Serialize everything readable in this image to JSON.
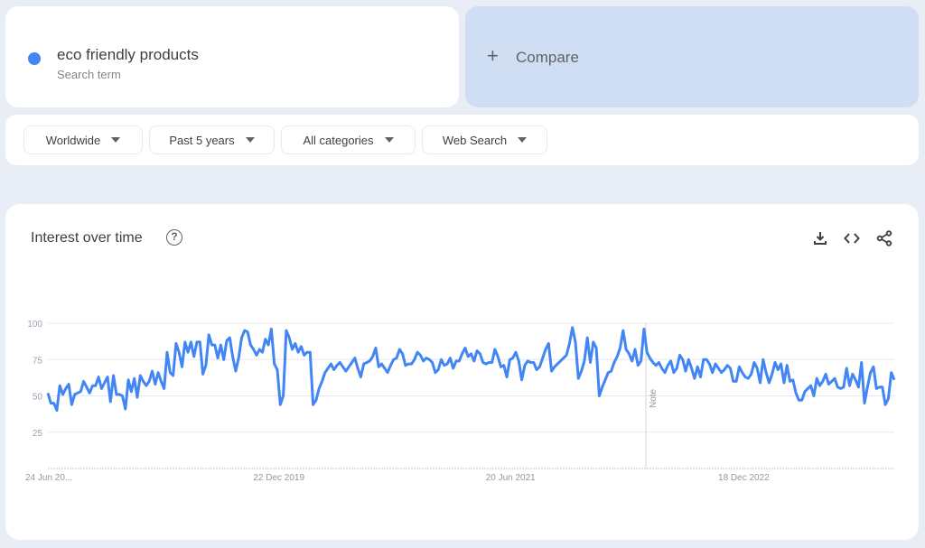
{
  "search_term": {
    "name": "eco friendly products",
    "subtitle": "Search term",
    "color": "#4285f4"
  },
  "compare": {
    "icon": "plus-icon",
    "label": "Compare"
  },
  "filters": [
    {
      "label": "Worldwide",
      "icon": "caret-down-icon"
    },
    {
      "label": "Past 5 years",
      "icon": "caret-down-icon"
    },
    {
      "label": "All categories",
      "icon": "caret-down-icon"
    },
    {
      "label": "Web Search",
      "icon": "caret-down-icon"
    }
  ],
  "panel": {
    "title": "Interest over time",
    "help_icon": "help-circle-icon",
    "help_glyph": "?",
    "actions": [
      "download-icon",
      "embed-code-icon",
      "share-icon"
    ]
  },
  "chart_data": {
    "type": "line",
    "title": "Interest over time",
    "xlabel": "",
    "ylabel": "",
    "ylim": [
      0,
      100
    ],
    "yticks": [
      25,
      50,
      75,
      100
    ],
    "xtick_labels": [
      "24 Jun 20...",
      "22 Dec 2019",
      "20 Jun 2021",
      "18 Dec 2022"
    ],
    "xtick_indices": [
      0,
      78,
      156,
      234
    ],
    "grid": true,
    "annotation": {
      "label": "Note",
      "index": 178
    },
    "series": [
      {
        "name": "eco friendly products",
        "color": "#4285f4",
        "values": [
          52,
          45,
          45,
          40,
          57,
          51,
          55,
          58,
          44,
          51,
          52,
          53,
          60,
          56,
          52,
          57,
          57,
          63,
          55,
          59,
          63,
          46,
          64,
          51,
          51,
          50,
          41,
          61,
          53,
          62,
          49,
          64,
          60,
          57,
          60,
          67,
          58,
          66,
          60,
          55,
          80,
          66,
          64,
          86,
          80,
          70,
          87,
          80,
          87,
          77,
          87,
          87,
          65,
          71,
          92,
          85,
          85,
          76,
          85,
          75,
          88,
          90,
          77,
          67,
          76,
          90,
          95,
          94,
          85,
          82,
          78,
          82,
          80,
          89,
          85,
          96,
          72,
          68,
          44,
          50,
          95,
          90,
          82,
          86,
          80,
          84,
          78,
          80,
          80,
          44,
          47,
          55,
          60,
          66,
          69,
          72,
          68,
          71,
          73,
          70,
          67,
          70,
          73,
          76,
          69,
          63,
          72,
          73,
          74,
          77,
          83,
          70,
          72,
          69,
          66,
          71,
          75,
          76,
          82,
          79,
          71,
          72,
          72,
          75,
          80,
          78,
          74,
          76,
          75,
          73,
          66,
          68,
          75,
          71,
          72,
          76,
          69,
          74,
          74,
          79,
          83,
          77,
          79,
          74,
          81,
          79,
          73,
          72,
          73,
          73,
          82,
          77,
          70,
          71,
          63,
          75,
          76,
          80,
          74,
          61,
          71,
          74,
          73,
          73,
          68,
          70,
          76,
          82,
          86,
          67,
          70,
          72,
          74,
          76,
          78,
          86,
          97,
          87,
          62,
          67,
          74,
          90,
          73,
          87,
          83,
          50,
          56,
          61,
          66,
          67,
          73,
          77,
          83,
          95,
          82,
          79,
          74,
          82,
          71,
          74,
          96,
          80,
          76,
          73,
          71,
          73,
          69,
          66,
          71,
          74,
          66,
          69,
          78,
          75,
          67,
          75,
          69,
          62,
          70,
          63,
          75,
          75,
          72,
          66,
          72,
          69,
          66,
          68,
          71,
          69,
          60,
          60,
          70,
          66,
          63,
          62,
          65,
          73,
          69,
          59,
          75,
          66,
          59,
          65,
          73,
          68,
          72,
          59,
          71,
          60,
          61,
          52,
          47,
          47,
          53,
          55,
          57,
          50,
          62,
          57,
          60,
          65,
          58,
          60,
          62,
          56,
          55,
          56,
          69,
          57,
          65,
          61,
          56,
          73,
          45,
          56,
          66,
          70,
          55,
          56,
          56,
          44,
          48,
          66,
          61
        ]
      }
    ]
  }
}
